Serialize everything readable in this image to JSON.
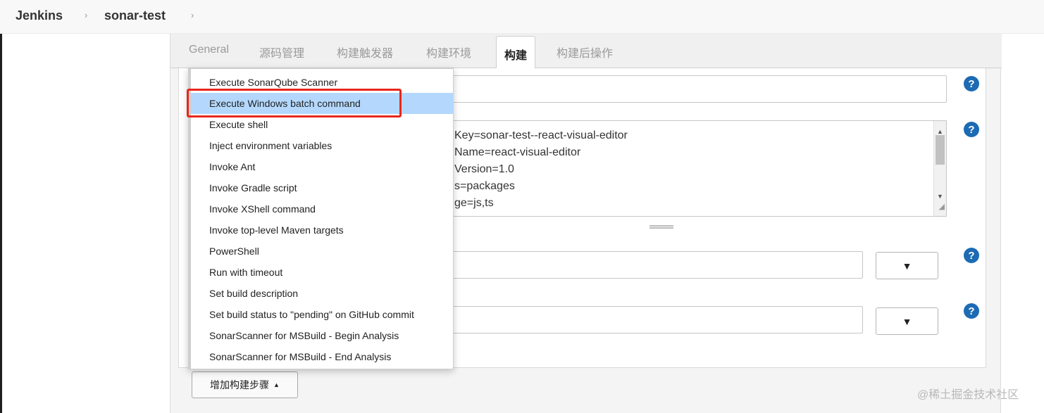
{
  "breadcrumb": {
    "app": "Jenkins",
    "job": "sonar-test",
    "separator": "›"
  },
  "tabs": [
    {
      "label": "General"
    },
    {
      "label": "源码管理"
    },
    {
      "label": "构建触发器"
    },
    {
      "label": "构建环境"
    },
    {
      "label": "构建",
      "active": true
    },
    {
      "label": "构建后操作"
    }
  ],
  "properties_lines": [
    "Key=sonar-test--react-visual-editor",
    "Name=react-visual-editor",
    "Version=1.0",
    "s=packages",
    "ge=js,ts"
  ],
  "help_icon_text": "?",
  "select_arrow": "▼",
  "dropdown": {
    "items": [
      "Execute SonarQube Scanner",
      "Execute Windows batch command",
      "Execute shell",
      "Inject environment variables",
      "Invoke Ant",
      "Invoke Gradle script",
      "Invoke XShell command",
      "Invoke top-level Maven targets",
      "PowerShell",
      "Run with timeout",
      "Set build description",
      "Set build status to \"pending\" on GitHub commit",
      "SonarScanner for MSBuild - Begin Analysis",
      "SonarScanner for MSBuild - End Analysis"
    ],
    "hovered_item": "Execute Windows batch command"
  },
  "add_step_button": {
    "label": "增加构建步骤",
    "caret": "▲"
  },
  "watermark": "@稀土掘金技术社区",
  "colors": {
    "hover_blue": "#b4d8fd",
    "highlight_red": "#e8271b",
    "help_blue": "#1c6bb3"
  }
}
